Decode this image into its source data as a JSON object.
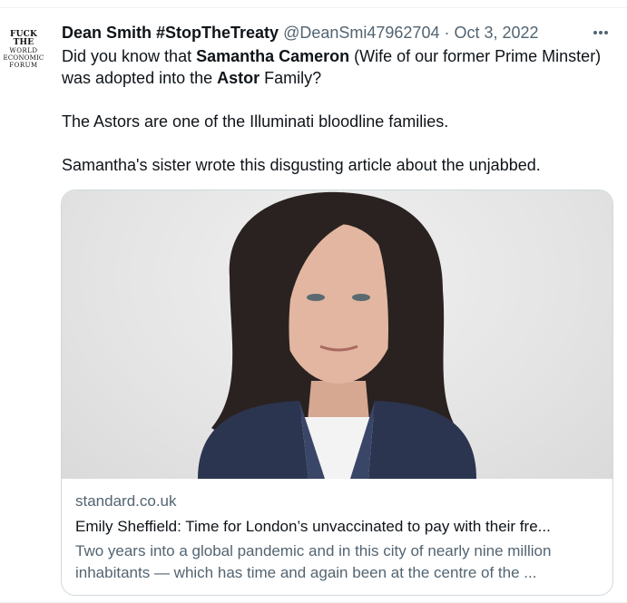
{
  "avatar": {
    "line1": "FUCK THE",
    "line2": "WORLD",
    "line3": "ECONOMIC",
    "line4": "FORUM"
  },
  "tweet": {
    "display_name": "Dean Smith #StopTheTreaty",
    "handle": "@DeanSmi47962704",
    "separator": "·",
    "date": "Oct 3, 2022",
    "more_icon": "more-horizontal-icon",
    "body": {
      "p1_pre": "Did you know that ",
      "p1_bold1": "Samantha Cameron",
      "p1_mid": " (Wife of our former Prime Minster) was adopted into the ",
      "p1_bold2": "Astor",
      "p1_post": " Family?",
      "p2": "The Astors are one of the Illuminati bloodline families.",
      "p3": "Samantha's sister wrote this disgusting article about the unjabbed."
    }
  },
  "card": {
    "domain": "standard.co.uk",
    "headline": "Emily Sheffield: Time for London’s unvaccinated to pay with their fre...",
    "desc_line1": "Two years into a global pandemic and in this city of nearly nine million",
    "desc_line2": "inhabitants — which has time and again been at the centre of the ..."
  },
  "colors": {
    "text": "#0f1419",
    "secondary": "#536471",
    "border": "#cfd9de"
  }
}
